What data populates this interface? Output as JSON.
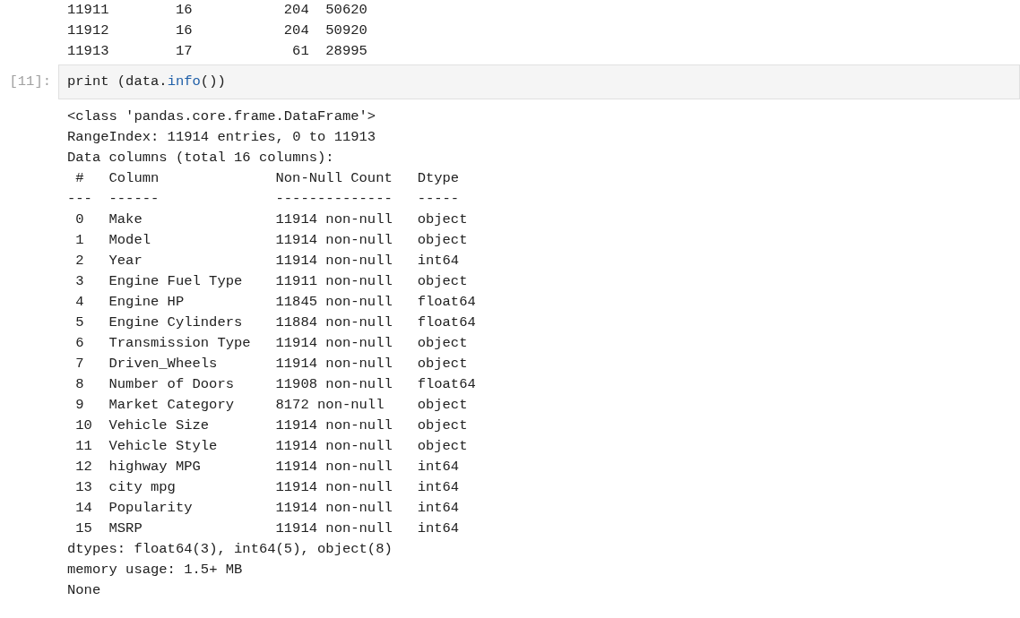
{
  "previous_output": {
    "lines": [
      [
        "11911",
        "16",
        "204",
        "50620"
      ],
      [
        "11912",
        "16",
        "204",
        "50920"
      ],
      [
        "11913",
        "17",
        "61",
        "28995"
      ]
    ]
  },
  "code_cell": {
    "prompt": "[11]:",
    "tokens": [
      {
        "kind": "plain",
        "text": "print (data."
      },
      {
        "kind": "attribute",
        "text": "info"
      },
      {
        "kind": "plain",
        "text": "())"
      }
    ]
  },
  "output": {
    "header_lines": [
      "<class 'pandas.core.frame.DataFrame'>",
      "RangeIndex: 11914 entries, 0 to 11913",
      "Data columns (total 16 columns):"
    ],
    "table": {
      "rows": [
        {
          "kind": "header",
          "cells": [
            "#",
            "Column",
            "Non-Null Count",
            "Dtype"
          ]
        },
        {
          "kind": "rule",
          "cells": [
            "---",
            "------",
            "--------------",
            "-----"
          ]
        },
        {
          "kind": "row",
          "cells": [
            "0",
            "Make",
            "11914 non-null",
            "object"
          ]
        },
        {
          "kind": "row",
          "cells": [
            "1",
            "Model",
            "11914 non-null",
            "object"
          ]
        },
        {
          "kind": "row",
          "cells": [
            "2",
            "Year",
            "11914 non-null",
            "int64"
          ]
        },
        {
          "kind": "row",
          "cells": [
            "3",
            "Engine Fuel Type",
            "11911 non-null",
            "object"
          ]
        },
        {
          "kind": "row",
          "cells": [
            "4",
            "Engine HP",
            "11845 non-null",
            "float64"
          ]
        },
        {
          "kind": "row",
          "cells": [
            "5",
            "Engine Cylinders",
            "11884 non-null",
            "float64"
          ]
        },
        {
          "kind": "row",
          "cells": [
            "6",
            "Transmission Type",
            "11914 non-null",
            "object"
          ]
        },
        {
          "kind": "row",
          "cells": [
            "7",
            "Driven_Wheels",
            "11914 non-null",
            "object"
          ]
        },
        {
          "kind": "row",
          "cells": [
            "8",
            "Number of Doors",
            "11908 non-null",
            "float64"
          ]
        },
        {
          "kind": "row",
          "cells": [
            "9",
            "Market Category",
            "8172 non-null",
            "object"
          ]
        },
        {
          "kind": "row",
          "cells": [
            "10",
            "Vehicle Size",
            "11914 non-null",
            "object"
          ]
        },
        {
          "kind": "row",
          "cells": [
            "11",
            "Vehicle Style",
            "11914 non-null",
            "object"
          ]
        },
        {
          "kind": "row",
          "cells": [
            "12",
            "highway MPG",
            "11914 non-null",
            "int64"
          ]
        },
        {
          "kind": "row",
          "cells": [
            "13",
            "city mpg",
            "11914 non-null",
            "int64"
          ]
        },
        {
          "kind": "row",
          "cells": [
            "14",
            "Popularity",
            "11914 non-null",
            "int64"
          ]
        },
        {
          "kind": "row",
          "cells": [
            "15",
            "MSRP",
            "11914 non-null",
            "int64"
          ]
        }
      ]
    },
    "footer_lines": [
      "dtypes: float64(3), int64(5), object(8)",
      "memory usage: 1.5+ MB",
      "None"
    ]
  }
}
